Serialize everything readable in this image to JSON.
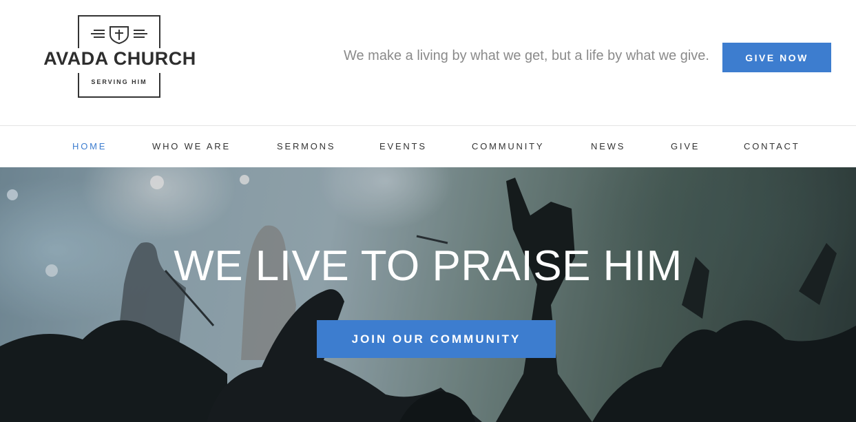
{
  "brand": {
    "name": "AVADA CHURCH",
    "subtitle": "SERVING HIM"
  },
  "header": {
    "tagline": "We make a living by what we get, but a life by what we give.",
    "give_label": "GIVE NOW"
  },
  "nav": {
    "items": [
      {
        "label": "HOME",
        "active": true
      },
      {
        "label": "WHO WE ARE",
        "active": false
      },
      {
        "label": "SERMONS",
        "active": false
      },
      {
        "label": "EVENTS",
        "active": false
      },
      {
        "label": "COMMUNITY",
        "active": false
      },
      {
        "label": "NEWS",
        "active": false
      },
      {
        "label": "GIVE",
        "active": false
      },
      {
        "label": "CONTACT",
        "active": false
      }
    ]
  },
  "hero": {
    "title": "WE LIVE TO PRAISE HIM",
    "cta_label": "JOIN OUR COMMUNITY"
  },
  "colors": {
    "accent": "#3d7dcf",
    "text_dark": "#333333",
    "text_muted": "#8a8a8a"
  },
  "icons": {
    "logo_emblem": "shield-cross-icon"
  }
}
